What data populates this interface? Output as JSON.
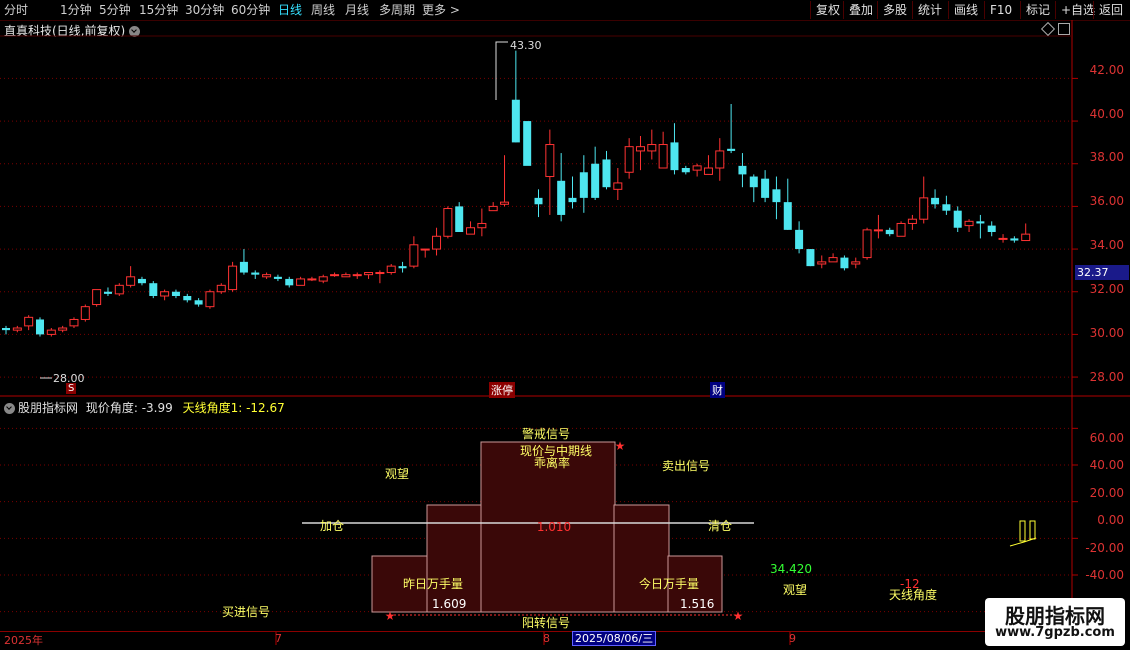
{
  "toolbar": {
    "periods": [
      "分时",
      "1分钟",
      "5分钟",
      "15分钟",
      "30分钟",
      "60分钟",
      "日线",
      "周线",
      "月线",
      "多周期",
      "更多 >"
    ],
    "active_period": "日线",
    "right_buttons": [
      "复权",
      "叠加",
      "多股",
      "统计",
      "画线",
      "F10",
      "+自选",
      "返回"
    ]
  },
  "main_chart": {
    "title": "直真科技(日线,前复权)",
    "current_price_tag": "32.37",
    "high_marker": "43.30",
    "low_marker": "28.00",
    "badges": {
      "zt": "涨停",
      "cai": "财",
      "s": "S"
    },
    "price_axis": [
      "42.00",
      "40.00",
      "38.00",
      "36.00",
      "34.00",
      "32.00",
      "30.00",
      "28.00"
    ]
  },
  "indicator": {
    "name": "股朋指标网",
    "xianjia_label": "现价角度: -3.99",
    "tianxian_label": "天线角度1: -12.67",
    "axis": [
      "60.00",
      "40.00",
      "20.00",
      "0.00",
      "-20.00",
      "-40.00"
    ],
    "labels": {
      "jingjie": "警戒信号",
      "guanwang1": "观望",
      "guanwang2": "观望",
      "maichu": "卖出信号",
      "xianjia_zhongqi": "现价与中期线",
      "guaililv": "乖离率",
      "jiacang": "加仓",
      "qingcang": "清仓",
      "center_value": "1.010",
      "zuori": "昨日万手量",
      "zuori_val": "1.609",
      "jinri": "今日万手量",
      "jinri_val": "1.516",
      "mairu": "买进信号",
      "yangzhuan": "阳转信号",
      "val_34": "34.420",
      "val_neg12": "-12",
      "tianxian": "天线角度"
    }
  },
  "date_axis": {
    "year": "2025年",
    "m7": "7",
    "m8": "8",
    "m9": "9",
    "current": "2025/08/06/三"
  },
  "watermark": {
    "line1": "股朋指标网",
    "line2": "www.7gpzb.com"
  },
  "colors": {
    "up": "#ff3333",
    "down": "#4ee6f0",
    "axis": "#b00000",
    "bar": "#3a0a0a"
  },
  "chart_data": {
    "type": "candlestick",
    "ohlc": [
      [
        30.3,
        30.4,
        30.0,
        30.2
      ],
      [
        30.2,
        30.4,
        30.1,
        30.3
      ],
      [
        30.4,
        30.9,
        30.2,
        30.8
      ],
      [
        30.7,
        30.8,
        29.9,
        30.0
      ],
      [
        30.0,
        30.3,
        29.9,
        30.2
      ],
      [
        30.2,
        30.4,
        30.1,
        30.3
      ],
      [
        30.4,
        30.8,
        30.3,
        30.7
      ],
      [
        30.7,
        31.4,
        30.6,
        31.3
      ],
      [
        31.4,
        32.1,
        31.3,
        32.1
      ],
      [
        32.0,
        32.2,
        31.8,
        31.9
      ],
      [
        31.9,
        32.4,
        31.8,
        32.3
      ],
      [
        32.3,
        33.2,
        32.2,
        32.7
      ],
      [
        32.6,
        32.7,
        32.3,
        32.4
      ],
      [
        32.4,
        32.5,
        31.7,
        31.8
      ],
      [
        31.8,
        32.1,
        31.6,
        32.0
      ],
      [
        32.0,
        32.1,
        31.7,
        31.8
      ],
      [
        31.8,
        31.9,
        31.5,
        31.6
      ],
      [
        31.6,
        31.7,
        31.3,
        31.4
      ],
      [
        31.3,
        32.1,
        31.2,
        32.0
      ],
      [
        32.0,
        32.4,
        31.9,
        32.3
      ],
      [
        32.1,
        33.4,
        32.0,
        33.2
      ],
      [
        33.4,
        34.0,
        32.8,
        32.9
      ],
      [
        32.9,
        33.0,
        32.6,
        32.8
      ],
      [
        32.7,
        32.9,
        32.6,
        32.8
      ],
      [
        32.7,
        32.8,
        32.5,
        32.6
      ],
      [
        32.6,
        32.7,
        32.2,
        32.3
      ],
      [
        32.3,
        32.7,
        32.3,
        32.6
      ],
      [
        32.6,
        32.7,
        32.5,
        32.6
      ],
      [
        32.5,
        32.8,
        32.4,
        32.7
      ],
      [
        32.8,
        32.9,
        32.7,
        32.8
      ],
      [
        32.7,
        32.9,
        32.7,
        32.8
      ],
      [
        32.8,
        32.9,
        32.6,
        32.8
      ],
      [
        32.8,
        32.9,
        32.6,
        32.9
      ],
      [
        32.9,
        33.0,
        32.4,
        32.9
      ],
      [
        32.9,
        33.3,
        32.8,
        33.2
      ],
      [
        33.2,
        33.4,
        32.9,
        33.1
      ],
      [
        33.2,
        34.6,
        33.1,
        34.2
      ],
      [
        34.0,
        34.0,
        33.6,
        34.0
      ],
      [
        34.0,
        35.0,
        33.7,
        34.6
      ],
      [
        34.6,
        36.0,
        34.5,
        35.9
      ],
      [
        36.0,
        36.2,
        34.8,
        34.8
      ],
      [
        34.7,
        35.3,
        34.7,
        35.0
      ],
      [
        35.0,
        35.9,
        34.6,
        35.2
      ],
      [
        35.8,
        36.2,
        35.8,
        36.0
      ],
      [
        36.1,
        38.4,
        36.0,
        36.2
      ],
      [
        41.0,
        43.3,
        39.0,
        39.0
      ],
      [
        40.0,
        39.9,
        39.7,
        37.9
      ],
      [
        36.4,
        36.8,
        35.5,
        36.1
      ],
      [
        37.4,
        39.6,
        35.6,
        38.9
      ],
      [
        37.2,
        38.5,
        35.3,
        35.6
      ],
      [
        36.4,
        37.4,
        35.9,
        36.2
      ],
      [
        37.6,
        38.4,
        35.7,
        36.4
      ],
      [
        38.0,
        38.8,
        36.3,
        36.4
      ],
      [
        38.2,
        38.6,
        36.8,
        36.9
      ],
      [
        36.8,
        37.8,
        36.3,
        37.1
      ],
      [
        37.6,
        39.2,
        37.3,
        38.8
      ],
      [
        38.6,
        39.3,
        37.7,
        38.8
      ],
      [
        38.6,
        39.6,
        38.2,
        38.9
      ],
      [
        37.8,
        39.5,
        37.8,
        38.9
      ],
      [
        39.0,
        39.9,
        37.5,
        37.7
      ],
      [
        37.8,
        37.9,
        37.5,
        37.6
      ],
      [
        37.7,
        38.0,
        37.4,
        37.9
      ],
      [
        37.5,
        38.4,
        37.5,
        37.8
      ],
      [
        37.8,
        39.2,
        37.2,
        38.6
      ],
      [
        38.7,
        40.8,
        38.5,
        38.6
      ],
      [
        37.9,
        38.5,
        36.9,
        37.5
      ],
      [
        37.4,
        37.5,
        36.2,
        36.9
      ],
      [
        37.3,
        37.7,
        36.2,
        36.4
      ],
      [
        36.8,
        37.4,
        35.4,
        36.2
      ],
      [
        36.2,
        37.3,
        34.9,
        34.9
      ],
      [
        34.9,
        35.3,
        33.8,
        34.0
      ],
      [
        34.0,
        34.0,
        33.2,
        33.2
      ],
      [
        33.3,
        33.7,
        33.1,
        33.4
      ],
      [
        33.4,
        33.8,
        33.4,
        33.6
      ],
      [
        33.6,
        33.7,
        33.0,
        33.1
      ],
      [
        33.3,
        33.6,
        33.1,
        33.4
      ],
      [
        33.6,
        35.0,
        33.5,
        34.9
      ],
      [
        34.9,
        35.6,
        34.5,
        34.9
      ],
      [
        34.9,
        35.0,
        34.6,
        34.7
      ],
      [
        34.6,
        35.3,
        34.6,
        35.2
      ],
      [
        35.2,
        35.6,
        34.9,
        35.4
      ],
      [
        35.4,
        37.4,
        35.2,
        36.4
      ],
      [
        36.4,
        36.8,
        35.9,
        36.1
      ],
      [
        36.1,
        36.5,
        35.6,
        35.8
      ],
      [
        35.8,
        36.0,
        34.8,
        35.0
      ],
      [
        35.1,
        35.4,
        34.8,
        35.3
      ],
      [
        35.3,
        35.6,
        34.5,
        35.2
      ],
      [
        35.1,
        35.3,
        34.6,
        34.8
      ],
      [
        34.5,
        34.7,
        34.3,
        34.5
      ],
      [
        34.5,
        34.6,
        34.3,
        34.4
      ],
      [
        34.4,
        35.2,
        34.4,
        34.7
      ]
    ],
    "ylim": [
      27.3,
      43.8
    ],
    "indicator_ylim": [
      -50,
      70
    ],
    "hline": 0
  }
}
